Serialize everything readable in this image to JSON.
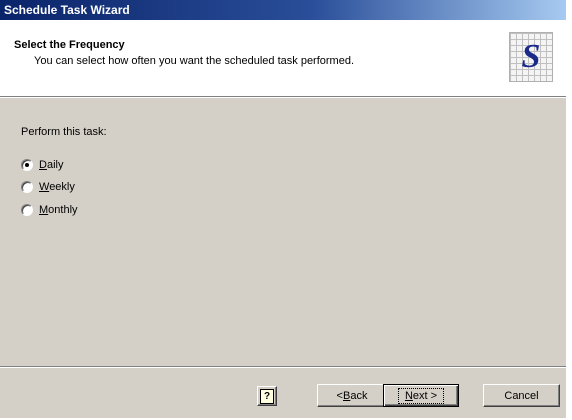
{
  "window": {
    "title": "Schedule Task Wizard"
  },
  "header": {
    "title": "Select the Frequency",
    "subtitle": "You can select how often you want the scheduled task performed.",
    "logo_letter": "S"
  },
  "main": {
    "prompt": "Perform this task:",
    "options": [
      {
        "label": "Daily",
        "mnemonic": "D",
        "rest": "aily",
        "selected": true
      },
      {
        "label": "Weekly",
        "mnemonic": "W",
        "rest": "eekly",
        "selected": false
      },
      {
        "label": "Monthly",
        "mnemonic": "M",
        "rest": "onthly",
        "selected": false
      }
    ]
  },
  "footer": {
    "help_icon": "help-icon",
    "help_glyph": "?",
    "back_prefix": "< ",
    "back_mnemonic": "B",
    "back_rest": "ack",
    "next_mnemonic": "N",
    "next_rest": "ext",
    "next_suffix": " >",
    "cancel_label": "Cancel"
  },
  "colors": {
    "titlebar_start": "#0a246a",
    "titlebar_end": "#a6caf0",
    "dialog_face": "#d4d0c8",
    "logo_letter": "#1b2a8a"
  }
}
